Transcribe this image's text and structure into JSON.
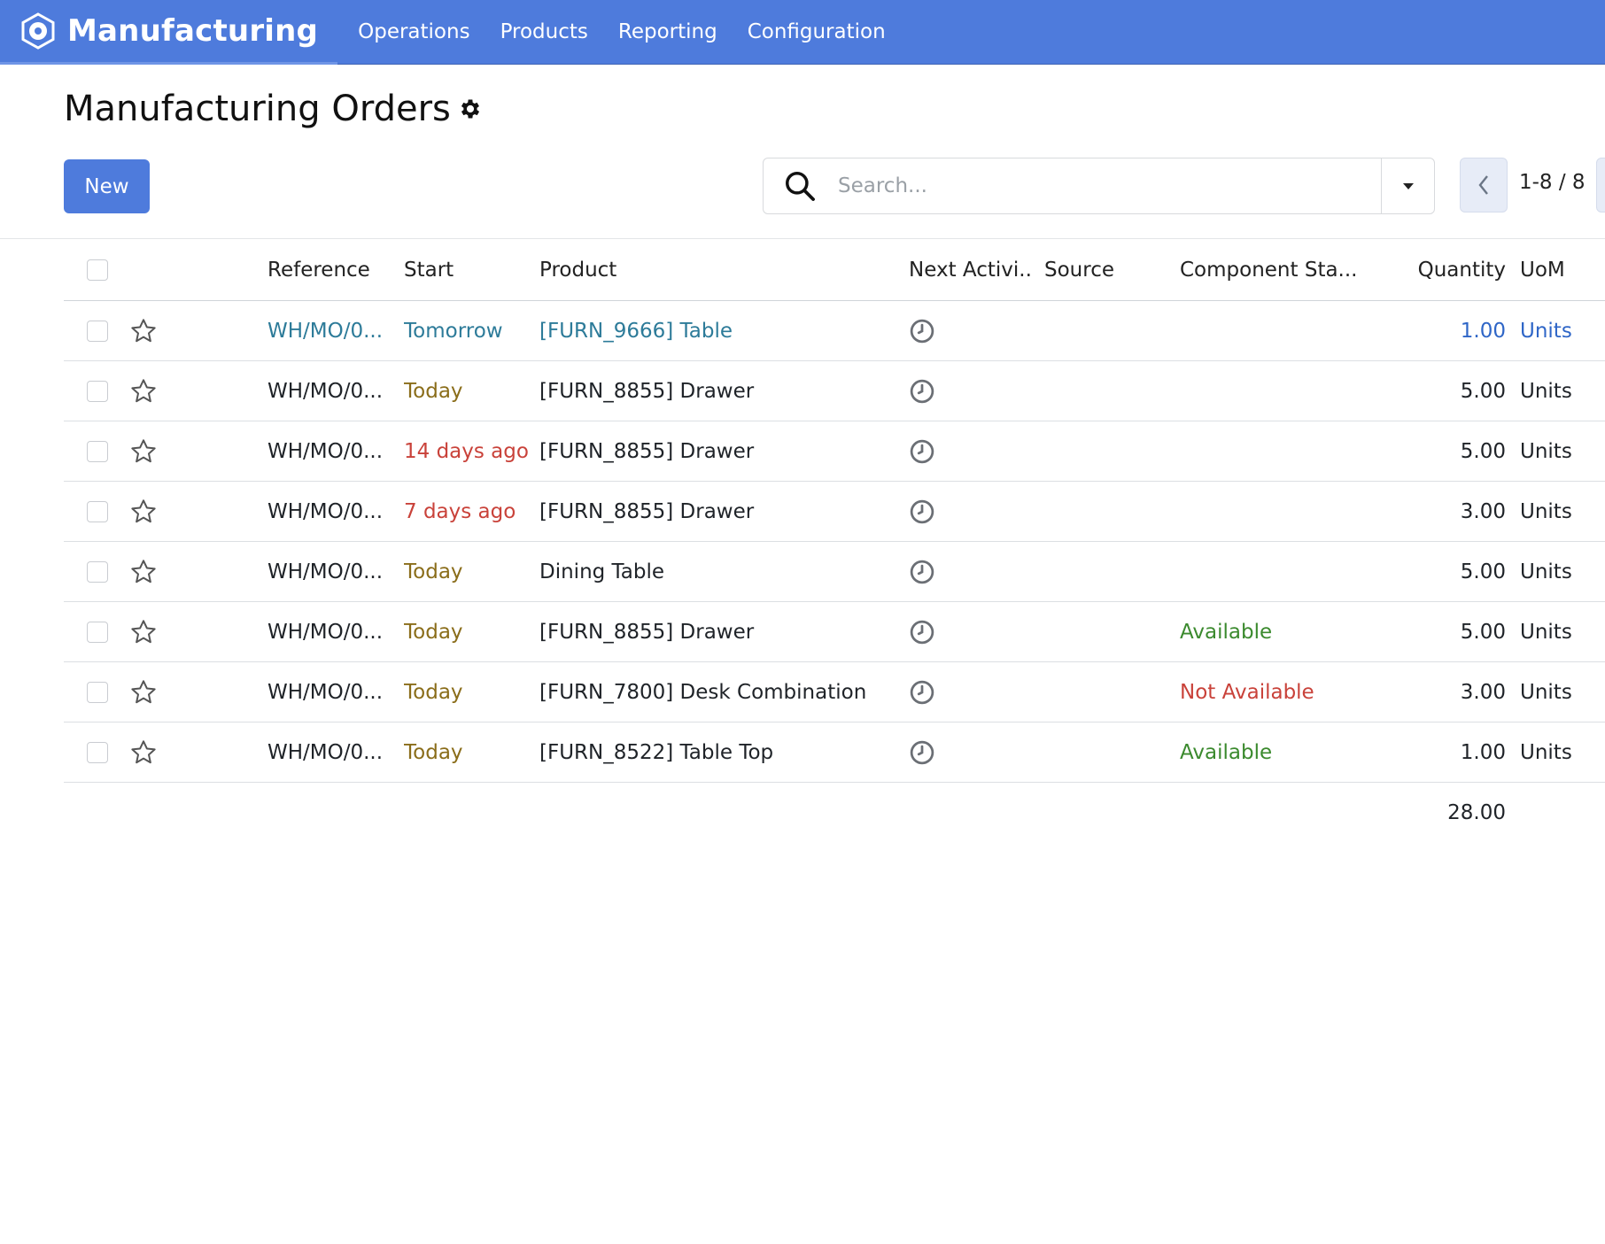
{
  "navbar": {
    "app_name": "Manufacturing",
    "app_icon": "manufacturing-logo-icon",
    "menu": [
      "Operations",
      "Products",
      "Reporting",
      "Configuration"
    ]
  },
  "control_panel": {
    "title": "Manufacturing Orders",
    "new_label": "New",
    "search_placeholder": "Search...",
    "pager": "1-8 / 8"
  },
  "table": {
    "headers": {
      "reference": "Reference",
      "start": "Start",
      "product": "Product",
      "next_activity": "Next Activi...",
      "source": "Source",
      "component_status": "Component Sta...",
      "quantity": "Quantity",
      "uom": "UoM"
    },
    "rows": [
      {
        "reference": "WH/MO/0...",
        "start": "Tomorrow",
        "start_style": "link",
        "product": "[FURN_9666] Table",
        "component_status": "",
        "component_style": "",
        "quantity": "1.00",
        "uom": "Units",
        "highlight": true
      },
      {
        "reference": "WH/MO/0...",
        "start": "Today",
        "start_style": "warning",
        "product": "[FURN_8855] Drawer",
        "component_status": "",
        "component_style": "",
        "quantity": "5.00",
        "uom": "Units",
        "highlight": false
      },
      {
        "reference": "WH/MO/0...",
        "start": "14 days ago",
        "start_style": "danger",
        "product": "[FURN_8855] Drawer",
        "component_status": "",
        "component_style": "",
        "quantity": "5.00",
        "uom": "Units",
        "highlight": false
      },
      {
        "reference": "WH/MO/0...",
        "start": "7 days ago",
        "start_style": "danger",
        "product": "[FURN_8855] Drawer",
        "component_status": "",
        "component_style": "",
        "quantity": "3.00",
        "uom": "Units",
        "highlight": false
      },
      {
        "reference": "WH/MO/0...",
        "start": "Today",
        "start_style": "warning",
        "product": "Dining Table",
        "component_status": "",
        "component_style": "",
        "quantity": "5.00",
        "uom": "Units",
        "highlight": false
      },
      {
        "reference": "WH/MO/0...",
        "start": "Today",
        "start_style": "warning",
        "product": "[FURN_8855] Drawer",
        "component_status": "Available",
        "component_style": "success",
        "quantity": "5.00",
        "uom": "Units",
        "highlight": false
      },
      {
        "reference": "WH/MO/0...",
        "start": "Today",
        "start_style": "warning",
        "product": "[FURN_7800] Desk Combination",
        "component_status": "Not Available",
        "component_style": "danger",
        "quantity": "3.00",
        "uom": "Units",
        "highlight": false
      },
      {
        "reference": "WH/MO/0...",
        "start": "Today",
        "start_style": "warning",
        "product": "[FURN_8522] Table Top",
        "component_status": "Available",
        "component_style": "success",
        "quantity": "1.00",
        "uom": "Units",
        "highlight": false
      }
    ],
    "total_quantity": "28.00"
  },
  "colors": {
    "navbar": "#4e7bdc",
    "primary": "#4e7bdc",
    "link": "#2d7b99",
    "warning": "#8a6d1a",
    "danger": "#c9423a",
    "success": "#3b8a2e"
  }
}
